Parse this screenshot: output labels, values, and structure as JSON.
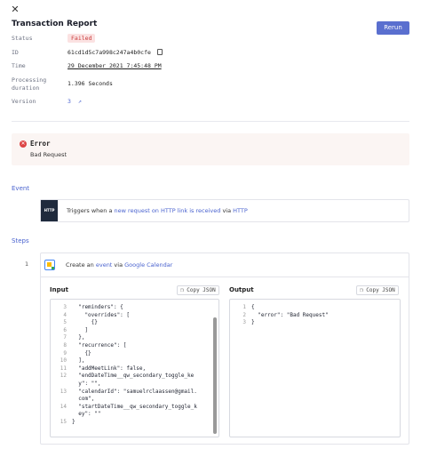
{
  "header": {
    "close": "✕",
    "title": "Transaction Report",
    "rerun_label": "Rerun"
  },
  "meta": {
    "status_label": "Status",
    "status_value": "Failed",
    "id_label": "ID",
    "id_value": "61cd1d5c7a998c247a4b0cfe",
    "time_label": "Time",
    "time_value": "29 December 2021 7:45:48 PM",
    "duration_label_1": "Processing",
    "duration_label_2": "duration",
    "duration_value": "1.396 Seconds",
    "version_label": "Version",
    "version_value": "3"
  },
  "error": {
    "icon": "✕",
    "title": "Error",
    "message": "Bad Request"
  },
  "event": {
    "section_label": "Event",
    "logo_text": "HTTP",
    "text_prefix": "Triggers when a ",
    "text_link": "new request on HTTP link is received",
    "text_mid": " via ",
    "text_app": "HTTP"
  },
  "steps": {
    "section_label": "Steps",
    "number": "1",
    "text_prefix": "Create an ",
    "text_link": "event",
    "text_mid": " via ",
    "text_app": "Google Calendar"
  },
  "input": {
    "label": "Input",
    "copy_label": "Copy JSON",
    "lines": [
      {
        "n": "3",
        "t": "  \"reminders\": {"
      },
      {
        "n": "4",
        "t": "    \"overrides\": ["
      },
      {
        "n": "5",
        "t": "      {}"
      },
      {
        "n": "6",
        "t": "    ]"
      },
      {
        "n": "7",
        "t": "  },"
      },
      {
        "n": "8",
        "t": "  \"recurrence\": ["
      },
      {
        "n": "9",
        "t": "    {}"
      },
      {
        "n": "10",
        "t": "  ],"
      },
      {
        "n": "11",
        "t": "  \"addMeetLink\": false,"
      },
      {
        "n": "12",
        "t": "  \"endDateTime__qw_secondary_toggle_ke"
      },
      {
        "n": "",
        "t": "  y\": \"\","
      },
      {
        "n": "13",
        "t": "  \"calendarId\": \"samuelrclaassen@gmail."
      },
      {
        "n": "",
        "t": "  com\","
      },
      {
        "n": "14",
        "t": "  \"startDateTime__qw_secondary_toggle_k"
      },
      {
        "n": "",
        "t": "  ey\": \"\""
      },
      {
        "n": "15",
        "t": "}"
      }
    ]
  },
  "output": {
    "label": "Output",
    "copy_label": "Copy JSON",
    "lines": [
      {
        "n": "1",
        "t": "{"
      },
      {
        "n": "2",
        "t": "  \"error\": \"Bad Request\""
      },
      {
        "n": "3",
        "t": "}"
      }
    ]
  }
}
